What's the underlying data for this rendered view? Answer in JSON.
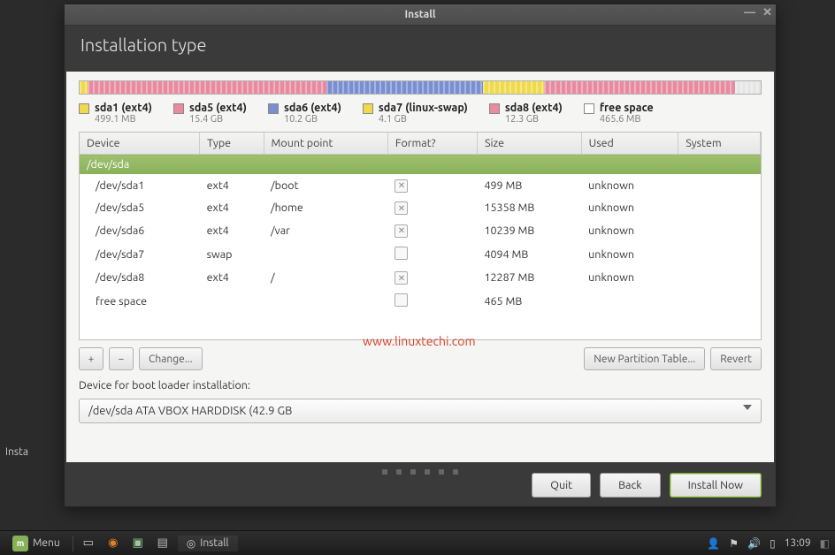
{
  "window": {
    "title": "Install",
    "header": "Installation type"
  },
  "partitions_bar": [
    {
      "color": "#f0d94a",
      "pct": 1.2
    },
    {
      "color": "#e88aa0",
      "pct": 35
    },
    {
      "color": "#7a8ed0",
      "pct": 23
    },
    {
      "color": "#f0d94a",
      "pct": 9
    },
    {
      "color": "#e88aa0",
      "pct": 28
    },
    {
      "color": "#e6e6e6",
      "pct": 3.8
    }
  ],
  "legend": [
    {
      "color": "#f0d94a",
      "label": "sda1 (ext4)",
      "size": "499.1 MB"
    },
    {
      "color": "#e88aa0",
      "label": "sda5 (ext4)",
      "size": "15.4 GB"
    },
    {
      "color": "#7a8ed0",
      "label": "sda6 (ext4)",
      "size": "10.2 GB"
    },
    {
      "color": "#f0d94a",
      "label": "sda7 (linux-swap)",
      "size": "4.1 GB"
    },
    {
      "color": "#e88aa0",
      "label": "sda8 (ext4)",
      "size": "12.3 GB"
    },
    {
      "color": "#ffffff",
      "label": "free space",
      "size": "465.6 MB"
    }
  ],
  "columns": [
    "Device",
    "Type",
    "Mount point",
    "Format?",
    "Size",
    "Used",
    "System"
  ],
  "disk_header": "/dev/sda",
  "rows": [
    {
      "device": "/dev/sda1",
      "type": "ext4",
      "mount": "/boot",
      "format": true,
      "size": "499 MB",
      "used": "unknown",
      "system": ""
    },
    {
      "device": "/dev/sda5",
      "type": "ext4",
      "mount": "/home",
      "format": true,
      "size": "15358 MB",
      "used": "unknown",
      "system": ""
    },
    {
      "device": "/dev/sda6",
      "type": "ext4",
      "mount": "/var",
      "format": true,
      "size": "10239 MB",
      "used": "unknown",
      "system": ""
    },
    {
      "device": "/dev/sda7",
      "type": "swap",
      "mount": "",
      "format": false,
      "size": "4094 MB",
      "used": "unknown",
      "system": ""
    },
    {
      "device": "/dev/sda8",
      "type": "ext4",
      "mount": "/",
      "format": true,
      "size": "12287 MB",
      "used": "unknown",
      "system": ""
    },
    {
      "device": "free space",
      "type": "",
      "mount": "",
      "format": false,
      "size": "465 MB",
      "used": "",
      "system": ""
    }
  ],
  "toolbar": {
    "add": "+",
    "remove": "−",
    "change": "Change...",
    "new_table": "New Partition Table...",
    "revert": "Revert"
  },
  "boot_loader": {
    "label": "Device for boot loader installation:",
    "value": "/dev/sda   ATA VBOX HARDDISK (42.9 GB"
  },
  "footer": {
    "quit": "Quit",
    "back": "Back",
    "install": "Install Now"
  },
  "watermark": "www.linuxtechi.com",
  "desktop": {
    "truncated": "Insta"
  },
  "taskbar": {
    "menu": "Menu",
    "task": "Install",
    "clock": "13:09"
  }
}
